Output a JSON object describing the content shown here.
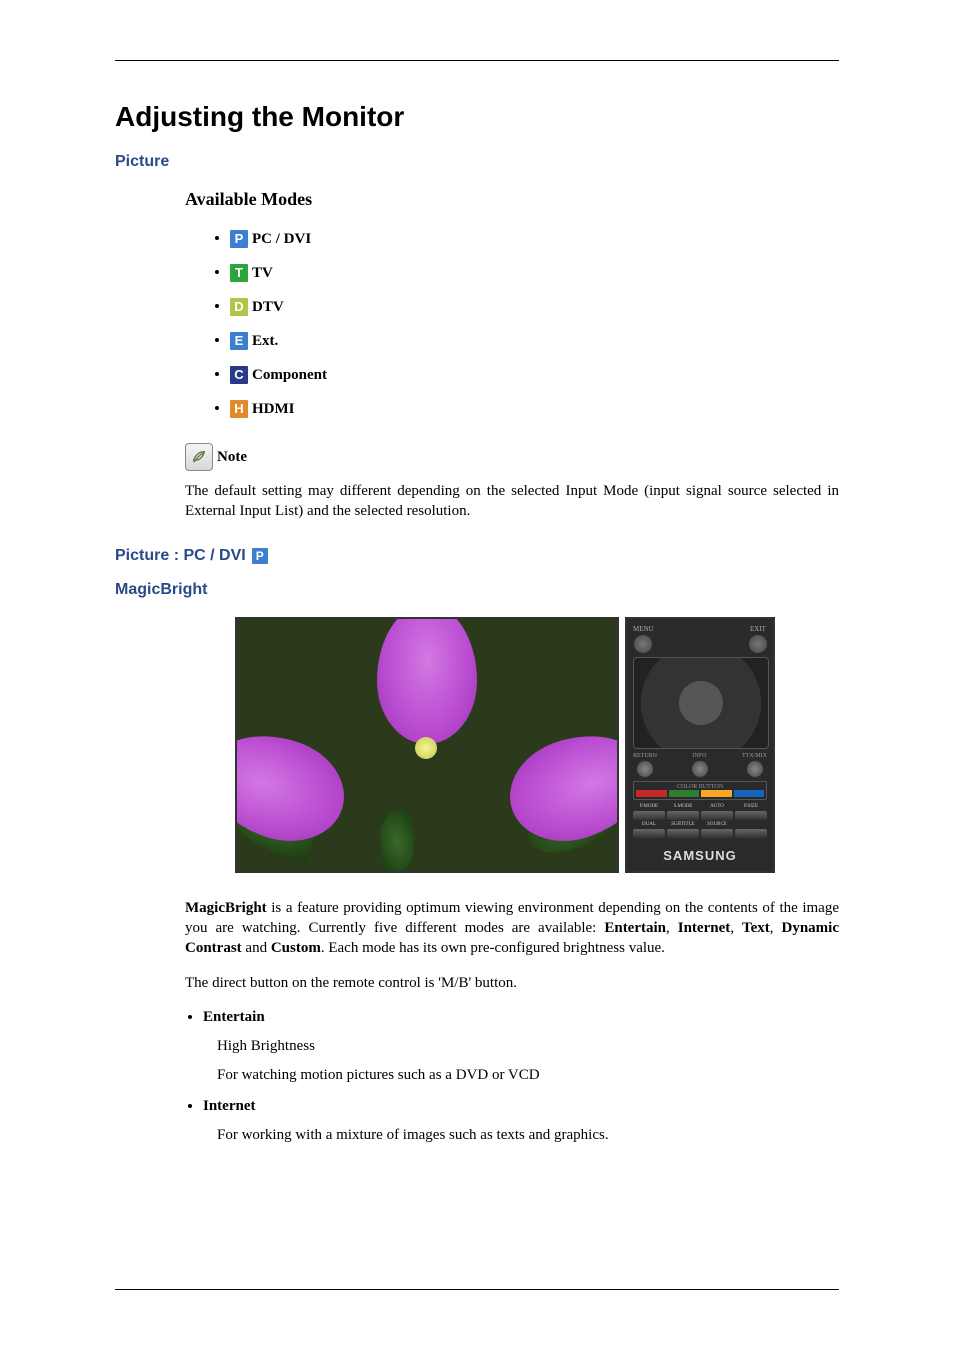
{
  "title": "Adjusting the Monitor",
  "sections": {
    "picture_label": "Picture",
    "available_modes_label": "Available Modes",
    "modes": [
      {
        "icon": "P",
        "cls": "ic-p",
        "label": "PC / DVI"
      },
      {
        "icon": "T",
        "cls": "ic-t",
        "label": "TV"
      },
      {
        "icon": "D",
        "cls": "ic-d",
        "label": "DTV"
      },
      {
        "icon": "E",
        "cls": "ic-e",
        "label": "Ext."
      },
      {
        "icon": "C",
        "cls": "ic-c",
        "label": "Component"
      },
      {
        "icon": "H",
        "cls": "ic-h",
        "label": "HDMI"
      }
    ],
    "note_label": "Note",
    "note_body": "The default setting may different depending on the selected Input Mode (input signal source selected in External Input List) and the selected resolution.",
    "picture_pc_dvi_label": "Picture : PC / DVI",
    "magicbright_label": "MagicBright",
    "remote": {
      "top_left": "MENU",
      "top_right": "EXIT",
      "row3": [
        "RETURN",
        "INFO",
        "TTX/MIX"
      ],
      "color_label": "COLOR BUTTON",
      "grid_labels": [
        "P.MODE",
        "S.MODE",
        "AUTO",
        "P.SIZE",
        "",
        "",
        "",
        "",
        "DUAL",
        "SUBTITLE",
        "SOURCE",
        ""
      ],
      "brand": "SAMSUNG"
    },
    "magicbright_desc_prefix": "MagicBright",
    "magicbright_desc_mid1": " is a feature providing optimum viewing environment depending on the contents of the image you are watching. Currently five different modes are available: ",
    "mb_modes": {
      "m1": "Entertain",
      "m2": "Internet",
      "m3": "Text",
      "m4": "Dynamic Contrast",
      "m5": "Custom"
    },
    "magicbright_desc_mid2": ". Each mode has its own pre-configured brightness value.",
    "direct_button": "The direct button on the remote control is 'M/B' button.",
    "items": [
      {
        "title": "Entertain",
        "lines": [
          "High Brightness",
          "For watching motion pictures such as a DVD or VCD"
        ]
      },
      {
        "title": "Internet",
        "lines": [
          "For working with a mixture of images such as texts and graphics."
        ]
      }
    ]
  }
}
